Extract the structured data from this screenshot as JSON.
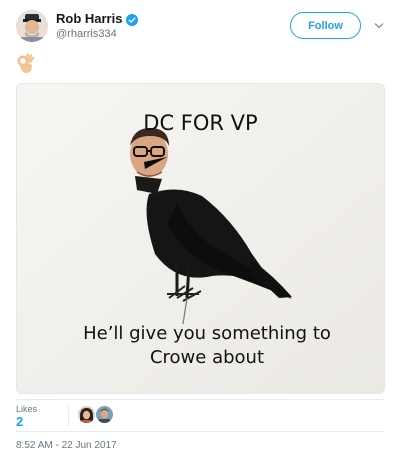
{
  "user": {
    "display_name": "Rob Harris",
    "handle": "@rharris334",
    "verified": true,
    "avatar_icon": "user-avatar"
  },
  "follow_button": {
    "label": "Follow"
  },
  "menu": {
    "icon": "chevron-down-icon"
  },
  "tweet": {
    "emoji": "ok-hand-emoji",
    "media": {
      "title": "DC FOR VP",
      "caption": "He’ll give you something to Crowe about"
    }
  },
  "stats": {
    "likes_label": "Likes",
    "likes_count": "2"
  },
  "timestamp": "8:52 AM - 22 Jun 2017",
  "colors": {
    "accent": "#1da1f2",
    "muted_text": "#657786",
    "divider": "#e6ecf0"
  }
}
